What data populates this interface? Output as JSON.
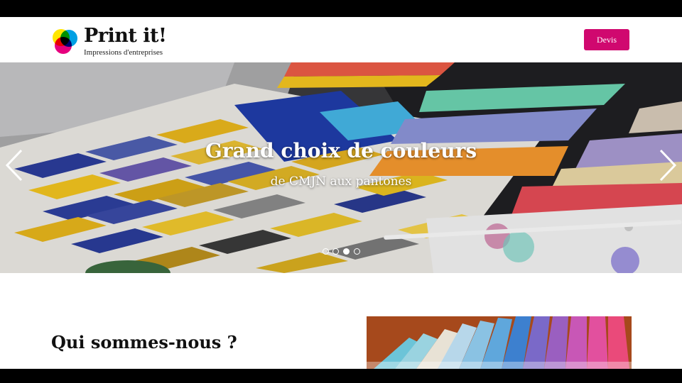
{
  "header": {
    "logo_title": "Print it!",
    "logo_subtitle": "Impressions d'entreprises",
    "devis_button": "Devis"
  },
  "hero": {
    "title": "Grand choix de couleurs",
    "subtitle": "de CMJN aux pantones",
    "slides_count": 4,
    "active_slide": 3
  },
  "about": {
    "title": "Qui sommes-nous ?"
  },
  "colors": {
    "brand": "#d0086f",
    "logo_cyan": "#00a0e3",
    "logo_magenta": "#e6007e",
    "logo_yellow": "#ffe600"
  },
  "icons": {
    "prev": "chevron-left-icon",
    "next": "chevron-right-icon"
  }
}
